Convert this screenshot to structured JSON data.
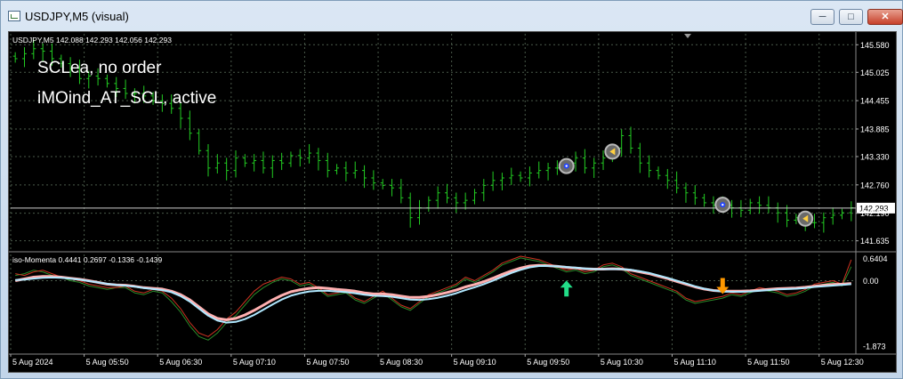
{
  "window": {
    "title": "USDJPY,M5 (visual)",
    "buttons": {
      "minimize": "─",
      "maximize": "□",
      "close": "✕"
    }
  },
  "colors": {
    "background": "#000000",
    "candle": "#22cc22",
    "grid": "#4a5a4a",
    "text": "#ffffff",
    "momentum_red": "#cc3322",
    "momentum_green": "#2a8a2a",
    "signal_pink": "#ffb0b0",
    "signal_cyan": "#b0e8ff",
    "arrow_up": "#22dd88",
    "arrow_down": "#ff9900"
  },
  "main_chart": {
    "info_line": "USDJPY,M5  142.088 142.293 142.056 142.293",
    "overlay_line1": "SCLea, no order",
    "overlay_line2": "iMOind_AT_SCL, active",
    "price_labels": [
      "145.580",
      "145.025",
      "144.455",
      "143.885",
      "143.330",
      "142.760",
      "142.293",
      "142.190",
      "141.635"
    ],
    "current_price": "142.293",
    "closes": [
      145.3,
      145.4,
      145.5,
      145.45,
      145.3,
      145.2,
      145.1,
      144.9,
      144.95,
      144.9,
      144.8,
      144.7,
      144.6,
      144.6,
      144.55,
      144.45,
      144.4,
      144.3,
      144.1,
      143.8,
      143.45,
      143.1,
      143.2,
      143.05,
      143.3,
      143.2,
      143.25,
      143.1,
      143.25,
      143.2,
      143.35,
      143.3,
      143.4,
      143.25,
      143.05,
      143.1,
      143.0,
      143.05,
      142.9,
      142.8,
      142.75,
      142.7,
      142.5,
      142.1,
      142.3,
      142.45,
      142.6,
      142.5,
      142.4,
      142.45,
      142.6,
      142.75,
      142.85,
      142.9,
      142.95,
      142.9,
      143.0,
      143.05,
      143.1,
      143.1,
      143.2,
      143.3,
      143.1,
      143.2,
      143.3,
      143.5,
      143.75,
      143.5,
      143.2,
      143.05,
      142.95,
      142.85,
      142.7,
      142.6,
      142.5,
      142.4,
      142.35,
      142.35,
      142.3,
      142.25,
      142.4,
      142.35,
      142.3,
      142.2,
      142.05,
      142.1,
      142.0,
      142.0,
      142.1,
      142.15,
      142.2,
      142.3
    ],
    "signal_markers": [
      {
        "index": 60,
        "price": 143.14,
        "kind": "dot"
      },
      {
        "index": 65,
        "price": 143.43,
        "kind": "arrow"
      },
      {
        "index": 77,
        "price": 142.36,
        "kind": "dot"
      },
      {
        "index": 86,
        "price": 142.08,
        "kind": "arrow"
      }
    ]
  },
  "sub_chart": {
    "info_line": "iso-Momenta 0.4441 0.2697 -0.1336 -0.1439",
    "y_labels": [
      "0.6404",
      "0.00",
      "-1.873"
    ],
    "momentum_red": [
      0.2,
      0.15,
      0.25,
      0.3,
      0.2,
      0.1,
      0.05,
      0.0,
      -0.1,
      -0.15,
      -0.2,
      -0.2,
      -0.15,
      -0.3,
      -0.35,
      -0.25,
      -0.3,
      -0.5,
      -0.8,
      -1.2,
      -1.5,
      -1.6,
      -1.4,
      -1.1,
      -0.9,
      -0.6,
      -0.3,
      -0.1,
      0.0,
      0.1,
      0.05,
      -0.1,
      -0.05,
      -0.2,
      -0.4,
      -0.35,
      -0.3,
      -0.5,
      -0.6,
      -0.45,
      -0.3,
      -0.5,
      -0.7,
      -0.8,
      -0.6,
      -0.4,
      -0.3,
      -0.2,
      -0.1,
      0.1,
      0.0,
      0.15,
      0.3,
      0.5,
      0.6,
      0.7,
      0.65,
      0.6,
      0.5,
      0.4,
      0.3,
      0.35,
      0.25,
      0.3,
      0.45,
      0.5,
      0.4,
      0.2,
      0.1,
      0.0,
      -0.1,
      -0.2,
      -0.3,
      -0.5,
      -0.6,
      -0.55,
      -0.5,
      -0.45,
      -0.35,
      -0.4,
      -0.3,
      -0.2,
      -0.25,
      -0.3,
      -0.4,
      -0.35,
      -0.25,
      -0.1,
      -0.05,
      0.0,
      -0.1,
      0.6
    ],
    "momentum_green": [
      0.15,
      0.2,
      0.3,
      0.25,
      0.15,
      0.1,
      0.0,
      -0.05,
      -0.15,
      -0.2,
      -0.25,
      -0.2,
      -0.2,
      -0.35,
      -0.4,
      -0.3,
      -0.35,
      -0.6,
      -0.9,
      -1.3,
      -1.6,
      -1.7,
      -1.5,
      -1.2,
      -1.0,
      -0.7,
      -0.4,
      -0.2,
      -0.05,
      0.05,
      0.0,
      -0.15,
      -0.1,
      -0.25,
      -0.45,
      -0.4,
      -0.35,
      -0.55,
      -0.65,
      -0.5,
      -0.35,
      -0.55,
      -0.75,
      -0.85,
      -0.65,
      -0.45,
      -0.35,
      -0.25,
      -0.15,
      0.05,
      -0.05,
      0.1,
      0.25,
      0.45,
      0.55,
      0.65,
      0.6,
      0.55,
      0.45,
      0.35,
      0.25,
      0.3,
      0.2,
      0.25,
      0.4,
      0.45,
      0.35,
      0.15,
      0.05,
      -0.05,
      -0.15,
      -0.25,
      -0.35,
      -0.55,
      -0.65,
      -0.6,
      -0.55,
      -0.5,
      -0.4,
      -0.45,
      -0.35,
      -0.25,
      -0.3,
      -0.35,
      -0.45,
      -0.4,
      -0.3,
      -0.15,
      -0.1,
      -0.05,
      -0.15,
      0.4
    ],
    "signal_pink": [
      0.0,
      0.05,
      0.1,
      0.12,
      0.12,
      0.1,
      0.07,
      0.04,
      0.0,
      -0.05,
      -0.1,
      -0.12,
      -0.13,
      -0.16,
      -0.2,
      -0.22,
      -0.24,
      -0.3,
      -0.4,
      -0.55,
      -0.75,
      -0.95,
      -1.08,
      -1.12,
      -1.08,
      -0.98,
      -0.85,
      -0.7,
      -0.55,
      -0.42,
      -0.32,
      -0.26,
      -0.22,
      -0.2,
      -0.22,
      -0.25,
      -0.27,
      -0.3,
      -0.35,
      -0.38,
      -0.38,
      -0.4,
      -0.44,
      -0.48,
      -0.48,
      -0.45,
      -0.4,
      -0.34,
      -0.27,
      -0.18,
      -0.11,
      -0.03,
      0.07,
      0.18,
      0.28,
      0.36,
      0.42,
      0.44,
      0.43,
      0.41,
      0.38,
      0.36,
      0.34,
      0.33,
      0.33,
      0.34,
      0.33,
      0.3,
      0.25,
      0.2,
      0.13,
      0.06,
      -0.02,
      -0.1,
      -0.18,
      -0.24,
      -0.28,
      -0.3,
      -0.3,
      -0.3,
      -0.29,
      -0.27,
      -0.25,
      -0.23,
      -0.22,
      -0.21,
      -0.19,
      -0.16,
      -0.13,
      -0.11,
      -0.1,
      -0.08
    ],
    "signal_cyan": [
      0.02,
      0.03,
      0.06,
      0.08,
      0.09,
      0.08,
      0.06,
      0.03,
      -0.01,
      -0.05,
      -0.09,
      -0.12,
      -0.14,
      -0.17,
      -0.21,
      -0.24,
      -0.27,
      -0.33,
      -0.44,
      -0.6,
      -0.8,
      -1.0,
      -1.14,
      -1.2,
      -1.18,
      -1.1,
      -0.98,
      -0.83,
      -0.68,
      -0.54,
      -0.43,
      -0.36,
      -0.31,
      -0.29,
      -0.29,
      -0.31,
      -0.33,
      -0.36,
      -0.4,
      -0.43,
      -0.44,
      -0.46,
      -0.5,
      -0.54,
      -0.55,
      -0.53,
      -0.49,
      -0.43,
      -0.36,
      -0.27,
      -0.19,
      -0.1,
      -0.0,
      0.11,
      0.22,
      0.31,
      0.38,
      0.42,
      0.42,
      0.41,
      0.39,
      0.37,
      0.35,
      0.33,
      0.33,
      0.33,
      0.33,
      0.31,
      0.27,
      0.22,
      0.15,
      0.08,
      0.0,
      -0.08,
      -0.16,
      -0.23,
      -0.28,
      -0.31,
      -0.32,
      -0.32,
      -0.31,
      -0.29,
      -0.27,
      -0.25,
      -0.24,
      -0.23,
      -0.21,
      -0.18,
      -0.16,
      -0.14,
      -0.12,
      -0.1
    ],
    "arrows": [
      {
        "index": 60,
        "dir": "up"
      },
      {
        "index": 77,
        "dir": "down"
      }
    ]
  },
  "time_labels": [
    "5 Aug 2024",
    "5 Aug 05:50",
    "5 Aug 06:30",
    "5 Aug 07:10",
    "5 Aug 07:50",
    "5 Aug 08:30",
    "5 Aug 09:10",
    "5 Aug 09:50",
    "5 Aug 10:30",
    "5 Aug 11:10",
    "5 Aug 11:50",
    "5 Aug 12:30"
  ]
}
